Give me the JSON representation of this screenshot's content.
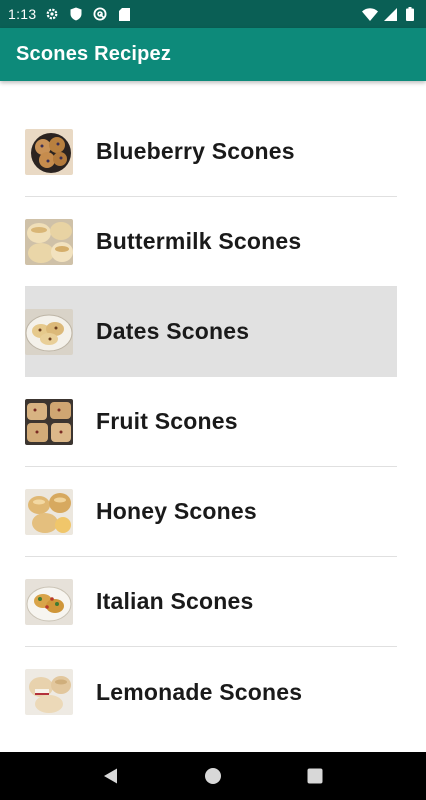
{
  "status_bar": {
    "time": "1:13",
    "left_icons": [
      "settings-gear-icon",
      "shield-icon",
      "at-sign-icon",
      "sd-card-icon"
    ],
    "right_icons": [
      "wifi-icon",
      "signal-icon",
      "battery-icon"
    ]
  },
  "app_bar": {
    "title": "Scones Recipez",
    "color": "#0d8a7a"
  },
  "recipes": [
    {
      "label": "Blueberry Scones",
      "thumb": "blueberry-scones-image"
    },
    {
      "label": "Buttermilk Scones",
      "thumb": "buttermilk-scones-image"
    },
    {
      "label": "Dates Scones",
      "thumb": "dates-scones-image",
      "selected": true
    },
    {
      "label": "Fruit Scones",
      "thumb": "fruit-scones-image"
    },
    {
      "label": "Honey Scones",
      "thumb": "honey-scones-image"
    },
    {
      "label": "Italian Scones",
      "thumb": "italian-scones-image"
    },
    {
      "label": "Lemonade Scones",
      "thumb": "lemonade-scones-image"
    }
  ],
  "nav_bar": {
    "buttons": [
      "back-icon",
      "home-icon",
      "recents-icon"
    ]
  },
  "colors": {
    "status_bar": "#0a5f55",
    "app_bar": "#0d8a7a",
    "selected_row": "#e1e1e1"
  }
}
